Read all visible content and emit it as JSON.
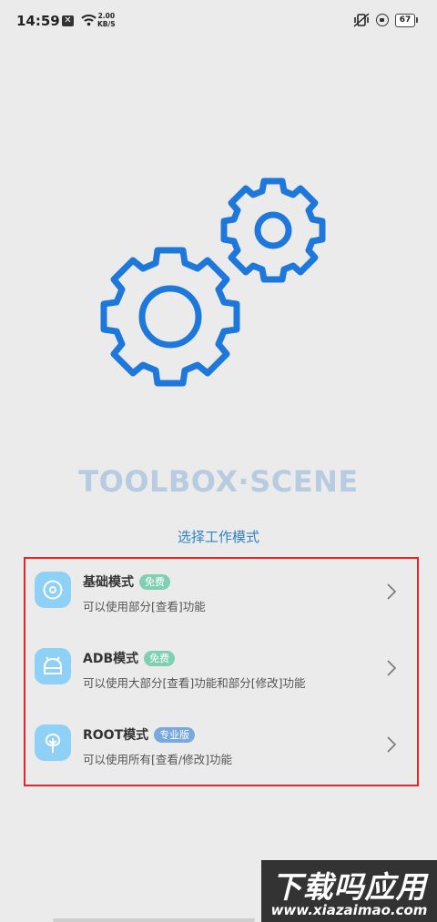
{
  "status_bar": {
    "time": "14:59",
    "net_speed_value": "2.00",
    "net_speed_unit": "KB/S",
    "battery": "67"
  },
  "app": {
    "title": "TOOLBOX·SCENE",
    "subtitle": "选择工作模式",
    "accent_color": "#1e78dc"
  },
  "modes": [
    {
      "name": "基础模式",
      "badge": "免费",
      "desc": "可以使用部分[查看]功能"
    },
    {
      "name": "ADB模式",
      "badge": "免费",
      "desc": "可以使用大部分[查看]功能和部分[修改]功能"
    },
    {
      "name": "ROOT模式",
      "badge": "专业版",
      "desc": "可以使用所有[查看/修改]功能"
    }
  ],
  "watermark": {
    "text": "下载吗应用",
    "url": "www.xiazaimao.com"
  }
}
